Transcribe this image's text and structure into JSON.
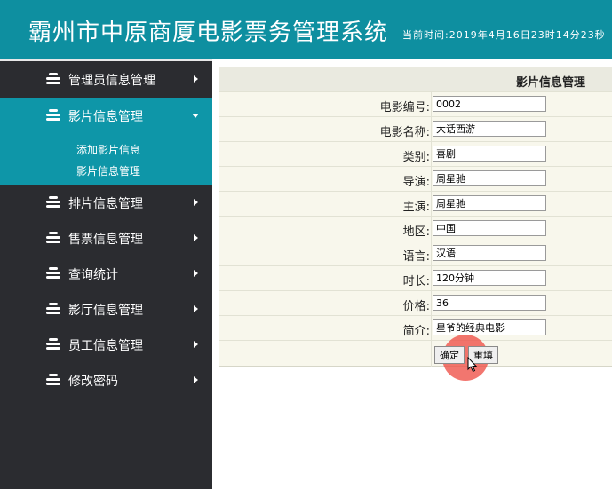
{
  "header": {
    "title": "霸州市中原商厦电影票务管理系统",
    "time_label": "当前时间:2019年4月16日23时14分23秒"
  },
  "sidebar": {
    "items": [
      {
        "label": "管理员信息管理"
      },
      {
        "label": "影片信息管理"
      },
      {
        "label": "排片信息管理"
      },
      {
        "label": "售票信息管理"
      },
      {
        "label": "查询统计"
      },
      {
        "label": "影厅信息管理"
      },
      {
        "label": "员工信息管理"
      },
      {
        "label": "修改密码"
      }
    ],
    "submenu": [
      {
        "label": "添加影片信息"
      },
      {
        "label": "影片信息管理"
      }
    ]
  },
  "form": {
    "title": "影片信息管理",
    "fields": [
      {
        "label": "电影编号:",
        "value": "0002"
      },
      {
        "label": "电影名称:",
        "value": "大话西游"
      },
      {
        "label": "类别:",
        "value": "喜剧"
      },
      {
        "label": "导演:",
        "value": "周星驰"
      },
      {
        "label": "主演:",
        "value": "周星驰"
      },
      {
        "label": "地区:",
        "value": "中国"
      },
      {
        "label": "语言:",
        "value": "汉语"
      },
      {
        "label": "时长:",
        "value": "120分钟"
      },
      {
        "label": "价格:",
        "value": "36"
      },
      {
        "label": "简介:",
        "value": "星爷的经典电影"
      }
    ],
    "confirm_label": "确定",
    "reset_label": "重填"
  },
  "colors": {
    "header_bg": "#0e8fa0",
    "sidebar_bg": "#2b2c30",
    "active_bg": "#0e96a8",
    "panel_bg": "#f8f7ec"
  }
}
